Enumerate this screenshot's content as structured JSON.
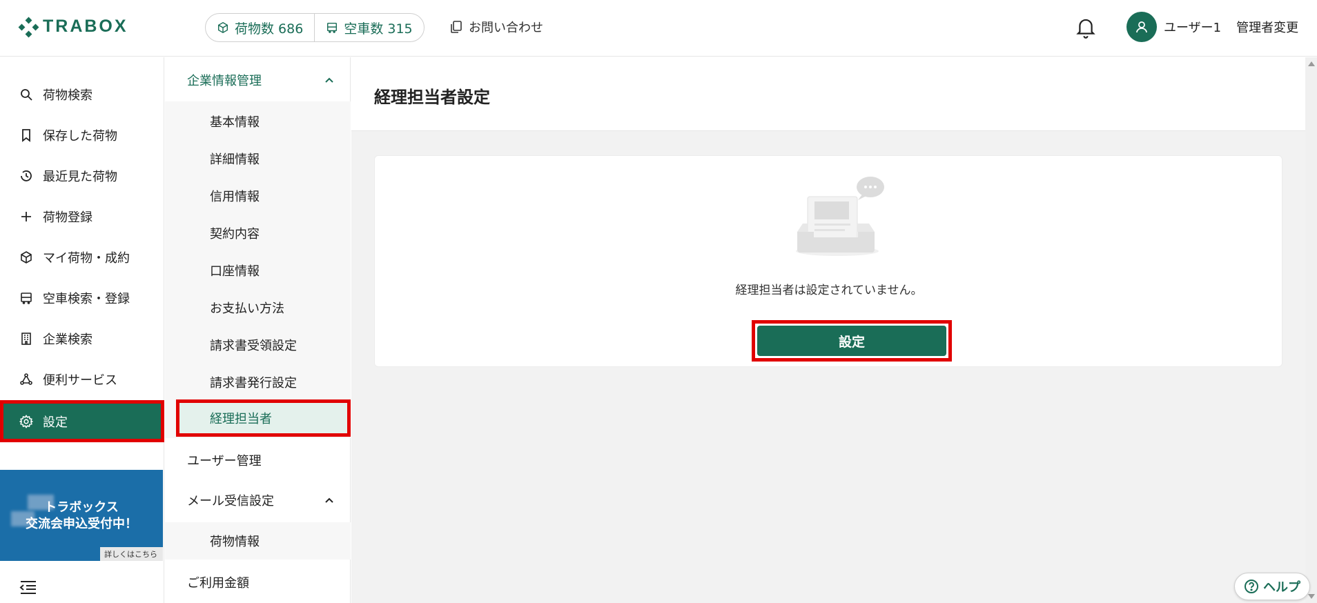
{
  "header": {
    "logo_text": "TRABOX",
    "cargo_count_label": "荷物数 686",
    "truck_count_label": "空車数 315",
    "contact_label": "お問い合わせ",
    "user_name": "ユーザー1",
    "admin_change_label": "管理者変更"
  },
  "sidebar": {
    "items": [
      {
        "label": "荷物検索",
        "icon": "search-icon"
      },
      {
        "label": "保存した荷物",
        "icon": "bookmark-icon"
      },
      {
        "label": "最近見た荷物",
        "icon": "history-icon"
      },
      {
        "label": "荷物登録",
        "icon": "plus-icon"
      },
      {
        "label": "マイ荷物・成約",
        "icon": "box-icon"
      },
      {
        "label": "空車検索・登録",
        "icon": "truck-icon"
      },
      {
        "label": "企業検索",
        "icon": "building-icon"
      },
      {
        "label": "便利サービス",
        "icon": "network-icon"
      },
      {
        "label": "設定",
        "icon": "gear-icon"
      }
    ],
    "banner": {
      "line1": "トラボックス",
      "line2": "交流会申込受付中！",
      "link": "詳しくはこちら"
    }
  },
  "submenu": {
    "group_company": "企業情報管理",
    "company_items": [
      "基本情報",
      "詳細情報",
      "信用情報",
      "契約内容",
      "口座情報",
      "お支払い方法",
      "請求書受領設定",
      "請求書発行設定",
      "経理担当者"
    ],
    "user_management": "ユーザー管理",
    "group_mail": "メール受信設定",
    "mail_items": [
      "荷物情報"
    ],
    "usage_fee": "ご利用金額"
  },
  "main": {
    "page_title": "経理担当者設定",
    "empty_message": "経理担当者は設定されていません。",
    "set_button": "設定",
    "help_label": "ヘルプ"
  },
  "colors": {
    "brand": "#1a6d57",
    "highlight": "#e10000",
    "banner": "#1b6ea8"
  }
}
